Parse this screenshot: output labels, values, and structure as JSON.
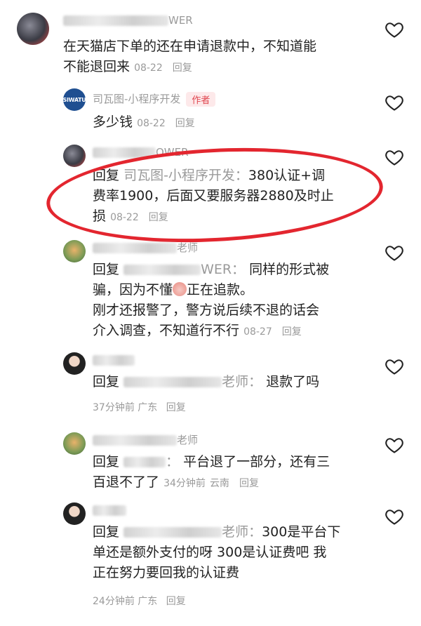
{
  "comments": [
    {
      "name_suffix": "WER",
      "lines": [
        "在天猫店下单的还在申请退款中，不知道能",
        "不能退回来"
      ],
      "date": "08-22",
      "reply_label": "回复"
    },
    {
      "name": "司瓦图-小程序开发",
      "avatar_text": "SIWATU",
      "author_tag": "作者",
      "lines": [
        "多少钱"
      ],
      "date": "08-22",
      "reply_label": "回复"
    },
    {
      "name_suffix": "OWER",
      "reply_prefix": "回复",
      "reply_to": "司瓦图-小程序开发：",
      "lines": [
        "380认证+调",
        "费率1900，后面又要服务器2880及时止",
        "损"
      ],
      "date": "08-22",
      "reply_label": "回复"
    },
    {
      "name_suffix": "老师",
      "reply_prefix": "回复",
      "reply_to_suffix": "WER：",
      "lines": [
        "同样的形式被",
        "骗，因为不懂",
        "正在追款。",
        "刚才还报警了，警方说后续不退的话会",
        "介入调查，不知道行不行"
      ],
      "date": "08-27",
      "reply_label": "回复"
    },
    {
      "reply_prefix": "回复",
      "reply_to_suffix": "老师：",
      "lines": [
        "退款了吗"
      ],
      "time": "37分钟前",
      "location": "广东",
      "reply_label": "回复"
    },
    {
      "name_suffix": "老师",
      "reply_prefix": "回复",
      "reply_to_suffix": "：",
      "lines": [
        "平台退了一部分，还有三",
        "百退不了了"
      ],
      "time": "34分钟前",
      "location": "云南",
      "reply_label": "回复"
    },
    {
      "reply_prefix": "回复",
      "reply_to_suffix": "老师：",
      "lines": [
        "300是平台下",
        "单还是额外支付的呀 300是认证费吧 我",
        "正在努力要回我的认证费"
      ],
      "time": "24分钟前",
      "location": "广东",
      "reply_label": "回复"
    }
  ],
  "icons": {
    "like": "heart-outline-icon"
  },
  "colors": {
    "highlight_oval": "#e3262f",
    "author_tag": "#e0464f"
  }
}
